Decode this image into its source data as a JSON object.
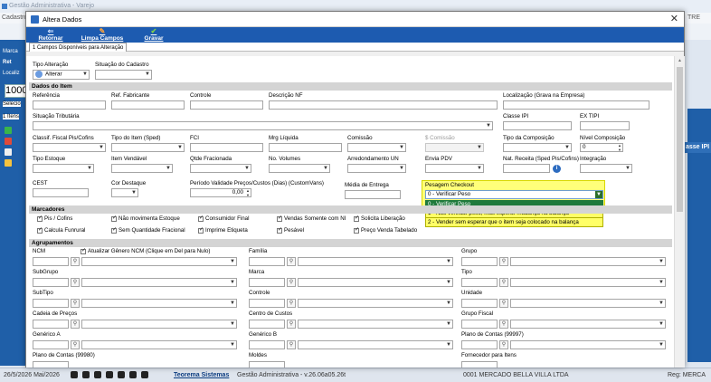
{
  "background": {
    "title": "Gestão Administrativa - Varejo",
    "menu_left": "Cadastros",
    "menu_right": "TRE",
    "left_labels": [
      "Marca",
      "Ret",
      "Localiz"
    ],
    "code_value": "1000",
    "left_labels2": [
      "Selecio",
      "1 Itens"
    ],
    "right_header": "asse IPI"
  },
  "status": {
    "date": "26/5/2026 Mai/2026",
    "brand": "Teorema Sistemas",
    "app": "Gestão Administrativa - v.26.06a05.26t",
    "company": "0001 MERCADO BELLA VILLA LTDA",
    "reg": "Reg: MERCA"
  },
  "modal": {
    "title": "Altera Dados",
    "close": "✕",
    "toolbar": {
      "retornar": "Retornar",
      "limpa_campos": "Limpa Campos",
      "gravar": "Gravar"
    },
    "tab": "1 Campos Disponíveis para Alteração"
  },
  "form": {
    "tipo_alteracao": {
      "label": "Tipo Alteração",
      "value": "Alterar"
    },
    "situacao_cadastro": {
      "label": "Situação do Cadastro",
      "value": ""
    },
    "sections": {
      "dados_item": "Dados do Item",
      "marcadores": "Marcadores",
      "agrupamentos": "Agrupamentos"
    },
    "labels": {
      "referencia": "Referência",
      "ref_fabricante": "Ref. Fabricante",
      "controle": "Controle",
      "descricao_nf": "Descrição NF",
      "localizacao": "Localização (Grava na Empresa)",
      "situacao_tributaria": "Situação Tributária",
      "classe_ipi": "Classe IPI",
      "ex_tipi": "EX TIPI",
      "classif_fiscal": "Classif. Fiscal Pis/Cofins",
      "tipo_item": "Tipo do Item (Sped)",
      "fci": "FCI",
      "mrg_liquida": "Mrg Líquida",
      "comissao": "Comissão",
      "s_comissao": "$ Comissão",
      "tipo_composicao": "Tipo da Composição",
      "nivel_composicao": "Nível Composição",
      "tipo_estoque": "Tipo Estoque",
      "item_vendavel": "Item Vendável",
      "qtde_fracionada": "Qtde Fracionada",
      "no_volumes": "No. Volumes",
      "arredondamento": "Arredondamento UN",
      "envia_pdv": "Envia PDV",
      "nat_receita": "Nat. Receita (Sped Pis/Cofins)",
      "integracao": "Integração",
      "cest": "CEST",
      "cor_destaque": "Cor Destaque",
      "periodo_validade": "Período Validade Preços/Custos (Dias) (CustomVans)",
      "media_entrega": "Média de Entrega",
      "pesagem_checkout": "Pesagem Checkout"
    },
    "nivel_composicao_value": "0",
    "periodo_value": "0,00",
    "pesagem": {
      "selected": "0 - Verificar Peso",
      "options": [
        "0 - Verificar Peso",
        "1 - Não verificar peso, mas esperar mudança na balança",
        "2 - Vender sem esperar que o item seja colocado na balança"
      ]
    },
    "marcadores": [
      {
        "label": "Pis / Cofins",
        "checked": true
      },
      {
        "label": "Não movimenta Estoque",
        "checked": true
      },
      {
        "label": "Consumidor Final",
        "checked": true
      },
      {
        "label": "Vendas Somente com NI",
        "checked": true
      },
      {
        "label": "Solicita Liberação",
        "checked": true
      },
      {
        "label": "Calcula Funrural",
        "checked": true
      },
      {
        "label": "Sem Quantidade Fracional",
        "checked": true
      },
      {
        "label": "Imprime Etiqueta",
        "checked": true
      },
      {
        "label": "Pesável",
        "checked": true
      },
      {
        "label": "Preço Venda Tabelado",
        "checked": true
      }
    ],
    "agrup": {
      "ncm": "NCM",
      "atualizar_genero": "Atualizar Gênero NCM (Clique em Del para Nulo)",
      "familia": "Família",
      "grupo": "Grupo",
      "subgrupo": "SubGrupo",
      "marca": "Marca",
      "tipo": "Tipo",
      "subtipo": "SubTipo",
      "controle": "Controle",
      "unidade": "Unidade",
      "cadeia_precos": "Cadeia de Preços",
      "centro_custos": "Centro de Custos",
      "grupo_fiscal": "Grupo Fiscal",
      "generico_a": "Genérico A",
      "generico_b": "Genérico B",
      "plano_contas_99997": "Plano de Contas (99997)",
      "plano_contas_99980": "Plano de Contas (99980)",
      "moldes": "Moldes",
      "fornecedor": "Fornecedor para Itens"
    }
  },
  "colors": {
    "ribbon": "#1d5bb0",
    "highlight": "#ffff7a",
    "selected_option": "#1f7a3d"
  }
}
